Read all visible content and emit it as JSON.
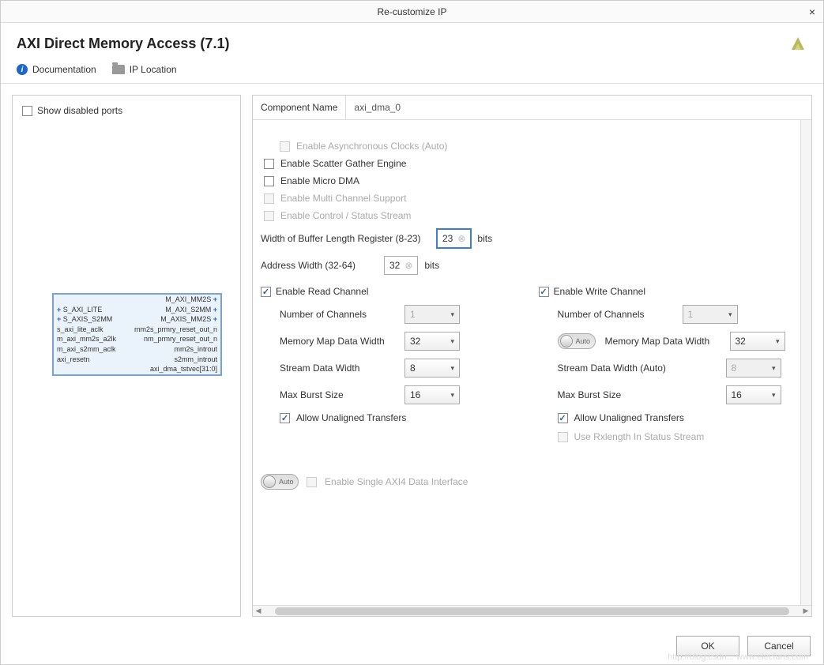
{
  "window": {
    "title": "Re-customize IP"
  },
  "header": {
    "title": "AXI Direct Memory Access (7.1)"
  },
  "toolbar": {
    "documentation": "Documentation",
    "ip_location": "IP Location"
  },
  "left": {
    "show_disabled_ports": "Show disabled ports",
    "block": {
      "left_pins": [
        "S_AXI_LITE",
        "S_AXIS_S2MM",
        "s_axi_lite_aclk",
        "m_axi_mm2s_a2lk",
        "m_axi_s2mm_aclk",
        "axi_resetn"
      ],
      "right_pins": [
        "M_AXI_MM2S",
        "M_AXI_S2MM",
        "M_AXIS_MM2S",
        "mm2s_prmry_reset_out_n",
        "nm_prmry_reset_out_n",
        "mm2s_introut",
        "s2mm_introut",
        "axi_dma_tstvec[31:0]"
      ]
    }
  },
  "main": {
    "component_name_label": "Component Name",
    "component_name": "axi_dma_0",
    "options": {
      "async_clocks": "Enable Asynchronous Clocks (Auto)",
      "scatter_gather": "Enable Scatter Gather Engine",
      "micro_dma": "Enable Micro DMA",
      "multi_channel": "Enable Multi Channel Support",
      "ctrl_status": "Enable Control / Status Stream"
    },
    "buffer_width": {
      "label": "Width of Buffer Length Register (8-23)",
      "value": "23",
      "unit": "bits"
    },
    "address_width": {
      "label": "Address Width (32-64)",
      "value": "32",
      "unit": "bits"
    },
    "read_channel": {
      "title": "Enable Read Channel",
      "num_channels_label": "Number of Channels",
      "num_channels": "1",
      "mm_width_label": "Memory Map Data Width",
      "mm_width": "32",
      "stream_width_label": "Stream Data Width",
      "stream_width": "8",
      "burst_label": "Max Burst Size",
      "burst": "16",
      "allow_unaligned": "Allow Unaligned Transfers"
    },
    "write_channel": {
      "title": "Enable Write Channel",
      "num_channels_label": "Number of Channels",
      "num_channels": "1",
      "mm_width_label": "Memory Map Data Width",
      "mm_width": "32",
      "stream_width_label": "Stream Data Width (Auto)",
      "stream_width": "8",
      "burst_label": "Max Burst Size",
      "burst": "16",
      "allow_unaligned": "Allow Unaligned Transfers",
      "use_rxlength": "Use Rxlength In Status Stream",
      "auto_label": "Auto"
    },
    "single_axi4": "Enable Single AXI4 Data Interface",
    "auto_label": "Auto"
  },
  "footer": {
    "ok": "OK",
    "cancel": "Cancel"
  },
  "watermark": "http://blog.csdn... www.elecfans.com"
}
